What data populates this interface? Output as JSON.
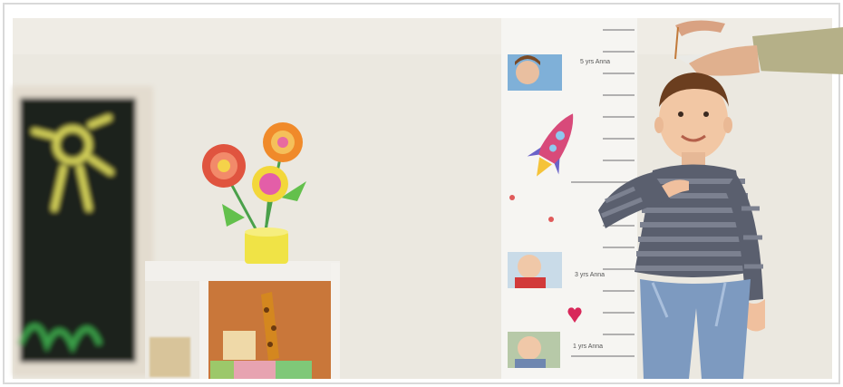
{
  "scene": {
    "growth_chart": {
      "labels": [
        "5 yrs Anna",
        "3 yrs Anna",
        "1 yrs Anna"
      ]
    },
    "colors": {
      "wall": "#ece9e1",
      "chalkboard": "#1f241f",
      "chalk_yellow": "#d7d45a",
      "chalk_green": "#3aa24a",
      "shelf_inner": "#c9773a",
      "rocket": "#d84a7a"
    }
  }
}
